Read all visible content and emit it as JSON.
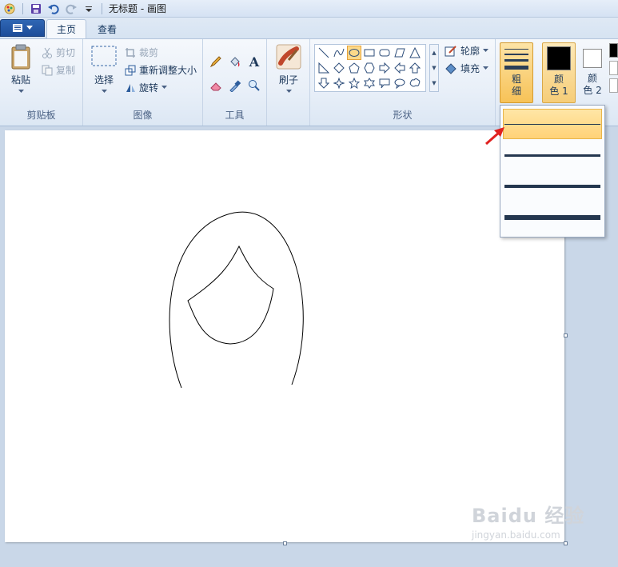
{
  "window": {
    "title": "无标题 - 画图"
  },
  "tabs": {
    "home": "主页",
    "view": "查看"
  },
  "clipboard": {
    "paste": "粘贴",
    "cut": "剪切",
    "copy": "复制",
    "group": "剪贴板"
  },
  "image": {
    "select": "选择",
    "crop": "裁剪",
    "resize": "重新调整大小",
    "rotate": "旋转",
    "group": "图像"
  },
  "tools": {
    "group": "工具",
    "text_glyph": "A"
  },
  "brushes": {
    "label": "刷子"
  },
  "shapes": {
    "outline": "轮廓",
    "fill": "填充",
    "group": "形状"
  },
  "size": {
    "label_line1": "粗",
    "label_line2": "细"
  },
  "color1": {
    "label_line1": "颜",
    "label_line2": "色 1",
    "value": "#000000"
  },
  "color2": {
    "label_line1": "颜",
    "label_line2": "色 2",
    "value": "#ffffff"
  },
  "size_dropdown": {
    "options": [
      {
        "name": "1px",
        "selected": true
      },
      {
        "name": "3px",
        "selected": false
      },
      {
        "name": "5px",
        "selected": false
      },
      {
        "name": "8px",
        "selected": false
      }
    ]
  },
  "watermark": {
    "brand": "Baidu 经验",
    "url": "jingyan.baidu.com"
  },
  "colors": {
    "ribbon_bg": "#e8eff8",
    "file_button": "#1c4c99",
    "selected_highlight": "#ffd278",
    "arrow": "#e0211f"
  }
}
